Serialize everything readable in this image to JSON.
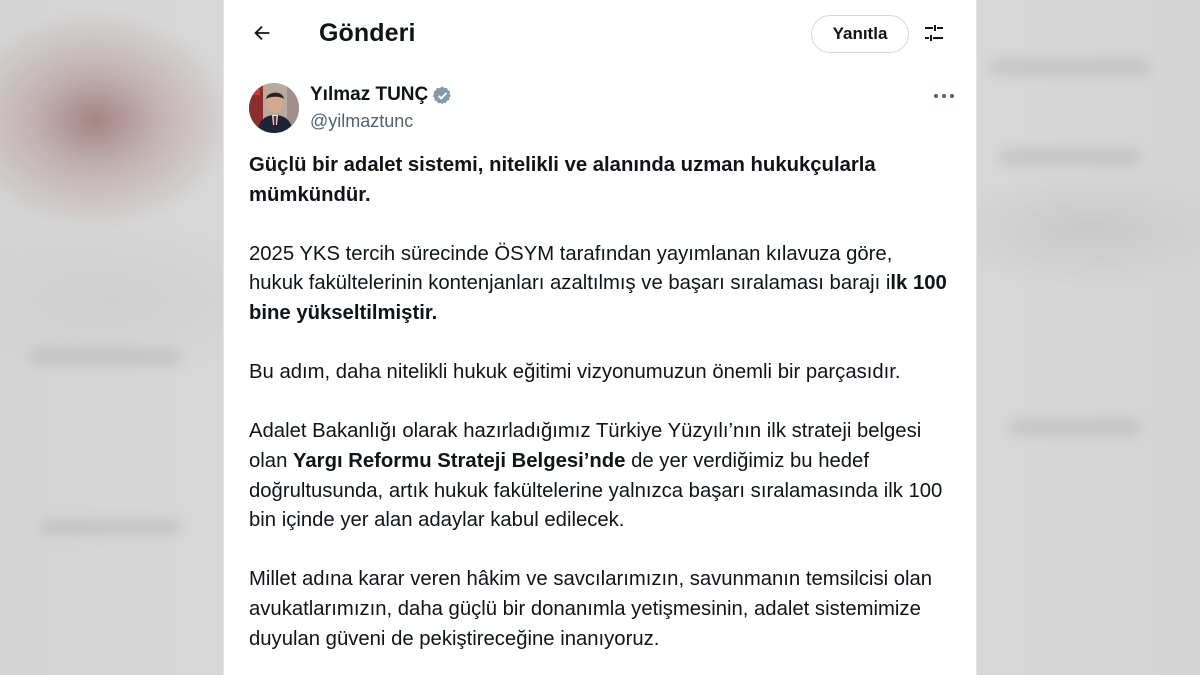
{
  "header": {
    "title": "Gönderi",
    "reply_label": "Yanıtla",
    "back_icon": "arrow-left-icon",
    "filter_icon": "sliders-icon"
  },
  "author": {
    "name": "Yılmaz TUNÇ",
    "handle": "@yilmaztunc",
    "verified": true,
    "verified_color": "#829aab"
  },
  "tweet": {
    "p1": "Güçlü bir adalet sistemi, nitelikli ve alanında uzman hukukçularla mümkündür.",
    "p2_a": "2025 YKS tercih sürecinde ÖSYM tarafından yayımlanan kılavuza göre, hukuk fakültelerinin kontenjanları azaltılmış ve başarı sıralaması barajı i",
    "p2_b": "lk 100 bine yükseltilmiştir.",
    "p3": "Bu adım, daha nitelikli hukuk eğitimi vizyonumuzun önemli bir parçasıdır.",
    "p4_a": "Adalet Bakanlığı olarak hazırladığımız Türkiye Yüzyılı’nın ilk strateji belgesi olan ",
    "p4_b": "Yargı Reformu Strateji Belgesi’nde",
    "p4_c": " de yer verdiğimiz bu hedef doğrultusunda, artık hukuk fakültelerine yalnızca başarı sıralamasında ilk 100 bin içinde yer alan adaylar kabul edilecek.",
    "p5": "Millet adına karar veren hâkim ve savcılarımızın, savunmanın temsilcisi olan avukatlarımızın, daha güçlü bir donanımla yetişmesinin, adalet sistemimize duyulan güveni de pekiştireceğine inanıyoruz."
  },
  "colors": {
    "text_primary": "#0f1419",
    "text_secondary": "#536471",
    "border": "#cfd9de"
  }
}
